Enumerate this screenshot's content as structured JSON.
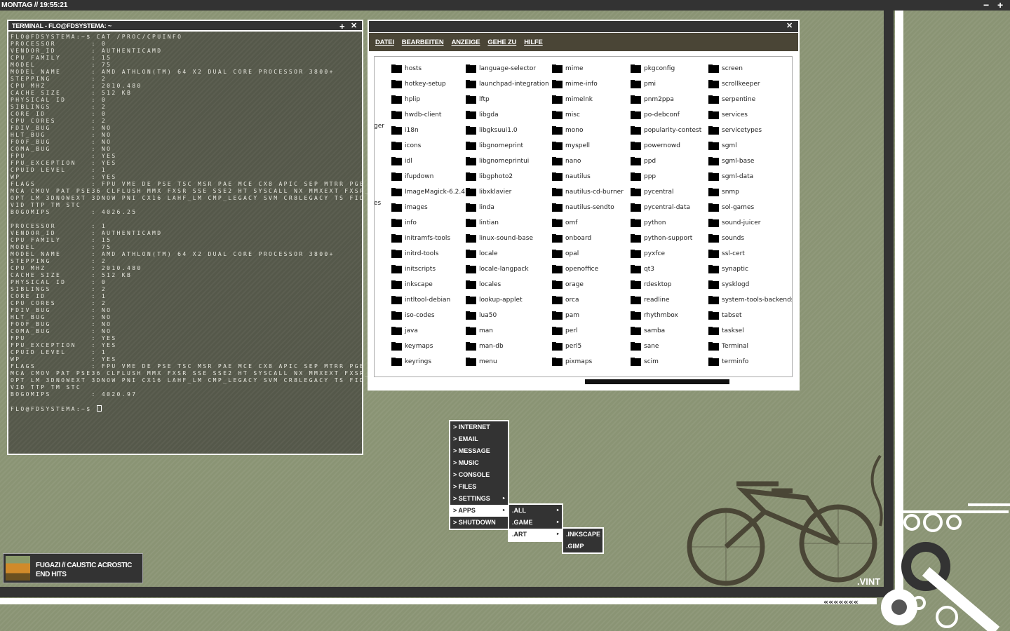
{
  "topbar": {
    "clock": "MONTAG // 19:55:21",
    "minimize": "−",
    "maximize": "+"
  },
  "terminal": {
    "title": "TERMINAL - FLO@FDSYSTEMA: ~",
    "btn_add": "+",
    "btn_close": "✕",
    "lines": [
      "FLO@FDSYSTEMA:~$ CAT /PROC/CPUINFO",
      "PROCESSOR       : 0",
      "VENDOR_ID       : AUTHENTICAMD",
      "CPU FAMILY      : 15",
      "MODEL           : 75",
      "MODEL NAME      : AMD ATHLON(TM) 64 X2 DUAL CORE PROCESSOR 3800+",
      "STEPPING        : 2",
      "CPU MHZ         : 2010.480",
      "CACHE SIZE      : 512 KB",
      "PHYSICAL ID     : 0",
      "SIBLINGS        : 2",
      "CORE ID         : 0",
      "CPU CORES       : 2",
      "FDIV_BUG        : NO",
      "HLT_BUG         : NO",
      "FOOF_BUG        : NO",
      "COMA_BUG        : NO",
      "FPU             : YES",
      "FPU_EXCEPTION   : YES",
      "CPUID LEVEL     : 1",
      "WP              : YES",
      "FLAGS           : FPU VME DE PSE TSC MSR PAE MCE CX8 APIC SEP MTRR PGE",
      "MCA CMOV PAT PSE36 CLFLUSH MMX FXSR SSE SSE2 HT SYSCALL NX MMXEXT FXSR_",
      "OPT LM 3DNOWEXT 3DNOW PNI CX16 LAHF_LM CMP_LEGACY SVM CR8LEGACY TS FID",
      "VID TTP TM STC",
      "BOGOMIPS        : 4026.25",
      "",
      "PROCESSOR       : 1",
      "VENDOR_ID       : AUTHENTICAMD",
      "CPU FAMILY      : 15",
      "MODEL           : 75",
      "MODEL NAME      : AMD ATHLON(TM) 64 X2 DUAL CORE PROCESSOR 3800+",
      "STEPPING        : 2",
      "CPU MHZ         : 2010.480",
      "CACHE SIZE      : 512 KB",
      "PHYSICAL ID     : 0",
      "SIBLINGS        : 2",
      "CORE ID         : 1",
      "CPU CORES       : 2",
      "FDIV_BUG        : NO",
      "HLT_BUG         : NO",
      "FOOF_BUG        : NO",
      "COMA_BUG        : NO",
      "FPU             : YES",
      "FPU_EXCEPTION   : YES",
      "CPUID LEVEL     : 1",
      "WP              : YES",
      "FLAGS           : FPU VME DE PSE TSC MSR PAE MCE CX8 APIC SEP MTRR PGE",
      "MCA CMOV PAT PSE36 CLFLUSH MMX FXSR SSE SSE2 HT SYSCALL NX MMXEXT FXSR_",
      "OPT LM 3DNOWEXT 3DNOW PNI CX16 LAHF_LM CMP_LEGACY SVM CR8LEGACY TS FID",
      "VID TTP TM STC",
      "BOGOMIPS        : 4020.97",
      ""
    ],
    "prompt": "FLO@FDSYSTEMA:~$ "
  },
  "filemanager": {
    "btn_close": "✕",
    "menu": [
      "DATEI",
      "BEARBEITEN",
      "ANZEIGE",
      "GEHE ZU",
      "HILFE"
    ],
    "cut_off": [
      "ger",
      "es"
    ],
    "columns": [
      [
        "hosts",
        "hotkey-setup",
        "hplip",
        "hwdb-client",
        "i18n",
        "icons",
        "idl",
        "ifupdown",
        "ImageMagick-6.2.4",
        "images",
        "info",
        "initramfs-tools",
        "initrd-tools",
        "initscripts",
        "inkscape",
        "intltool-debian",
        "iso-codes",
        "java",
        "keymaps",
        "keyrings"
      ],
      [
        "language-selector",
        "launchpad-integration",
        "lftp",
        "libgda",
        "libgksuui1.0",
        "libgnomeprint",
        "libgnomeprintui",
        "libgphoto2",
        "libxklavier",
        "linda",
        "lintian",
        "linux-sound-base",
        "locale",
        "locale-langpack",
        "locales",
        "lookup-applet",
        "lua50",
        "man",
        "man-db",
        "menu"
      ],
      [
        "mime",
        "mime-info",
        "mimelnk",
        "misc",
        "mono",
        "myspell",
        "nano",
        "nautilus",
        "nautilus-cd-burner",
        "nautilus-sendto",
        "omf",
        "onboard",
        "opal",
        "openoffice",
        "orage",
        "orca",
        "pam",
        "perl",
        "perl5",
        "pixmaps"
      ],
      [
        "pkgconfig",
        "pmi",
        "pnm2ppa",
        "po-debconf",
        "popularity-contest",
        "powernowd",
        "ppd",
        "ppp",
        "pycentral",
        "pycentral-data",
        "python",
        "python-support",
        "pyxfce",
        "qt3",
        "rdesktop",
        "readline",
        "rhythmbox",
        "samba",
        "sane",
        "scim"
      ],
      [
        "screen",
        "scrollkeeper",
        "serpentine",
        "services",
        "servicetypes",
        "sgml",
        "sgml-base",
        "sgml-data",
        "snmp",
        "sol-games",
        "sound-juicer",
        "sounds",
        "ssl-cert",
        "synaptic",
        "sysklogd",
        "system-tools-backends",
        "tabset",
        "tasksel",
        "Terminal",
        "terminfo"
      ]
    ]
  },
  "launcher": {
    "main": [
      "> INTERNET",
      "> EMAIL",
      "> MESSAGE",
      "> MUSIC",
      "> CONSOLE",
      "> FILES",
      "> SETTINGS",
      "> APPS",
      "> SHUTDOWN"
    ],
    "main_selected": "> APPS",
    "apps": [
      ".ALL",
      ".GAME",
      ".ART"
    ],
    "apps_selected": ".ART",
    "art": [
      ".INKSCAPE",
      ".GIMP"
    ]
  },
  "music": {
    "line1": "FUGAZI // CAUSTIC ACROSTIC",
    "line2": "END HITS"
  },
  "wallpaper": {
    "tag": ".VINT"
  },
  "colors": {
    "background": "#8a9474",
    "dark": "#333333",
    "menubar": "#4a4536",
    "terminal_bg": "#55584a"
  }
}
